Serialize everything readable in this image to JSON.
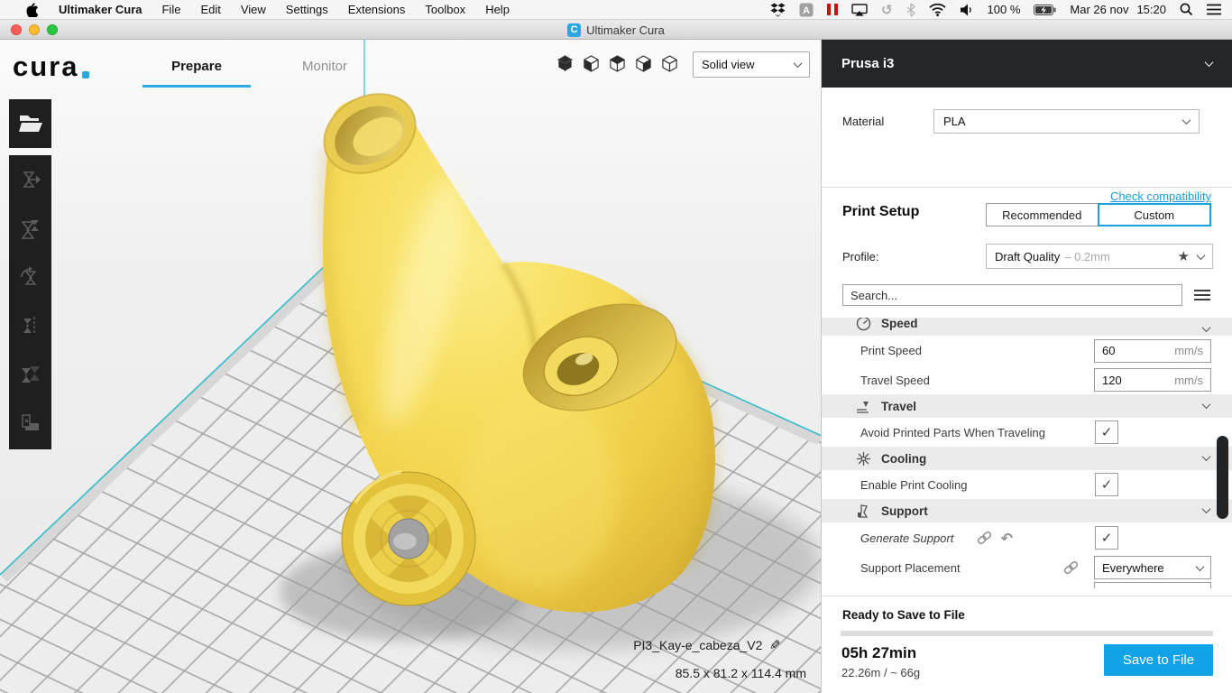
{
  "menu_bar": {
    "app_name": "Ultimaker Cura",
    "items": [
      "File",
      "Edit",
      "View",
      "Settings",
      "Extensions",
      "Toolbox",
      "Help"
    ],
    "battery_percent": "100 %",
    "date": "Mar 26 nov",
    "time": "15:20"
  },
  "window": {
    "title": "Ultimaker Cura"
  },
  "header": {
    "logo": "cura",
    "tab_prepare": "Prepare",
    "tab_monitor": "Monitor",
    "view_mode": "Solid view"
  },
  "viewport": {
    "model_name": "PI3_Kay-e_cabeza_V2",
    "model_dimensions": "85.5 x 81.2 x 114.4 mm"
  },
  "machine": {
    "name": "Prusa i3",
    "material_label": "Material",
    "material": "PLA",
    "check_compatibility": "Check compatibility"
  },
  "print_setup": {
    "title": "Print Setup",
    "recommended": "Recommended",
    "custom": "Custom",
    "profile_label": "Profile:",
    "profile": "Draft Quality",
    "profile_detail": "– 0.2mm",
    "star": "★",
    "search_placeholder": "Search..."
  },
  "settings": {
    "speed_header": "Speed",
    "print_speed": {
      "label": "Print Speed",
      "value": "60",
      "unit": "mm/s"
    },
    "travel_speed": {
      "label": "Travel Speed",
      "value": "120",
      "unit": "mm/s"
    },
    "travel_header": "Travel",
    "avoid_parts": {
      "label": "Avoid Printed Parts When Traveling",
      "checked": "✓"
    },
    "cooling_header": "Cooling",
    "enable_cooling": {
      "label": "Enable Print Cooling",
      "checked": "✓"
    },
    "support_header": "Support",
    "generate_support": {
      "label": "Generate Support",
      "checked": "✓",
      "undo": "↶"
    },
    "support_placement": {
      "label": "Support Placement",
      "value": "Everywhere"
    }
  },
  "footer": {
    "status": "Ready to Save to File",
    "print_time": "05h 27min",
    "material_usage": "22.26m / ~ 66g",
    "save_button": "Save to File"
  },
  "colors": {
    "accent_blue": "#12a3e6",
    "link_blue": "#1d9cd8",
    "plate_edge_cyan": "#35bccd",
    "model_yellow": "#f2d347"
  }
}
